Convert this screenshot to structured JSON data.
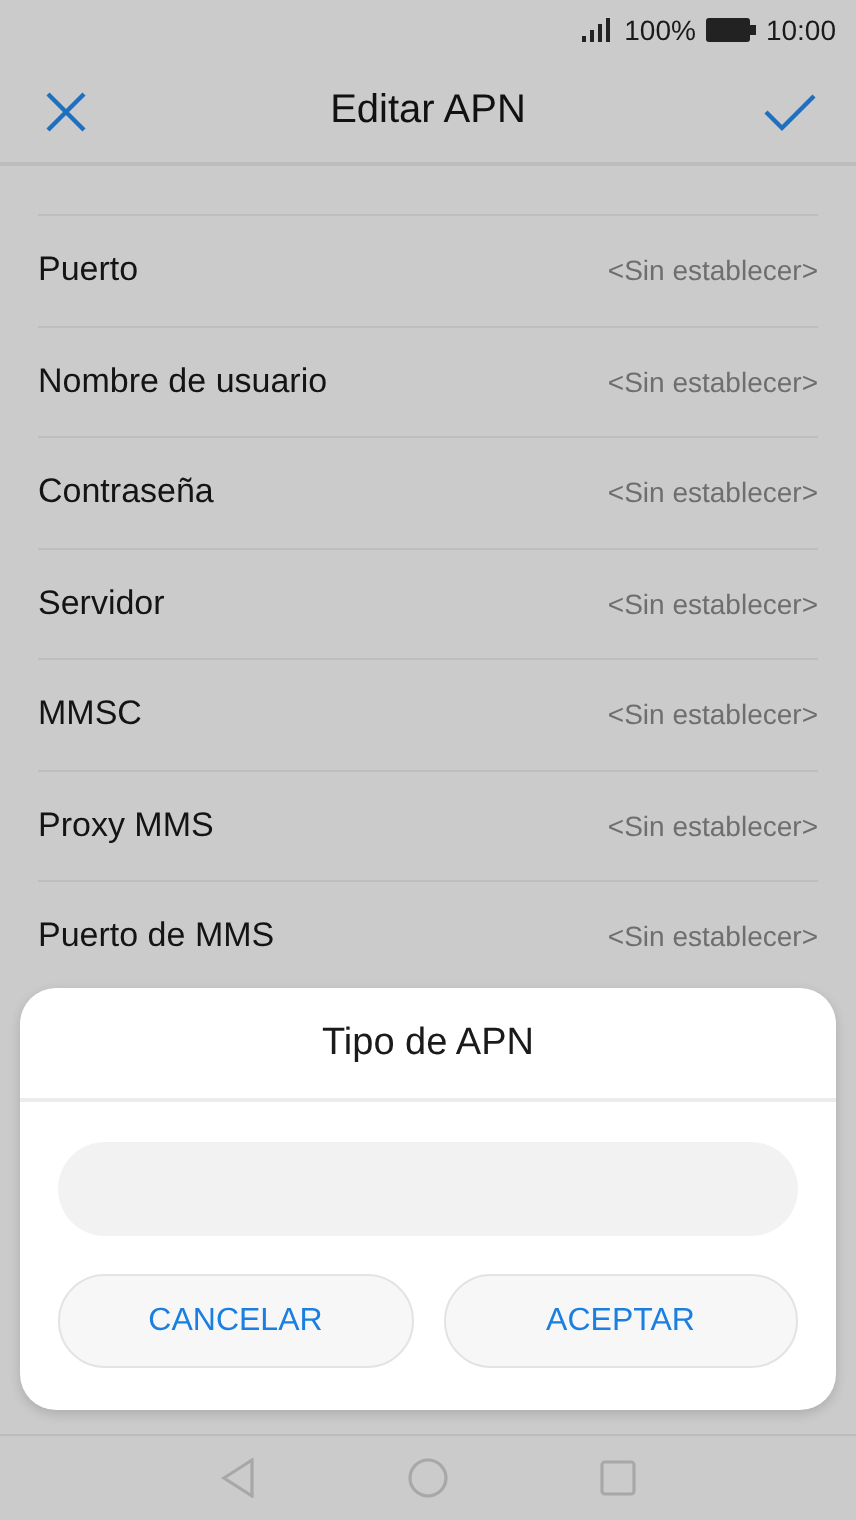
{
  "status_bar": {
    "battery": "100%",
    "time": "10:00"
  },
  "header": {
    "title": "Editar APN"
  },
  "fields": [
    {
      "label": "Puerto",
      "value": "<Sin establecer>"
    },
    {
      "label": "Nombre de usuario",
      "value": "<Sin establecer>"
    },
    {
      "label": "Contraseña",
      "value": "<Sin establecer>"
    },
    {
      "label": "Servidor",
      "value": "<Sin establecer>"
    },
    {
      "label": "MMSC",
      "value": "<Sin establecer>"
    },
    {
      "label": "Proxy MMS",
      "value": "<Sin establecer>"
    },
    {
      "label": "Puerto de MMS",
      "value": "<Sin establecer>"
    }
  ],
  "dialog": {
    "title": "Tipo de APN",
    "buttons": [
      "CANCELAR",
      "ACEPTAR"
    ]
  }
}
